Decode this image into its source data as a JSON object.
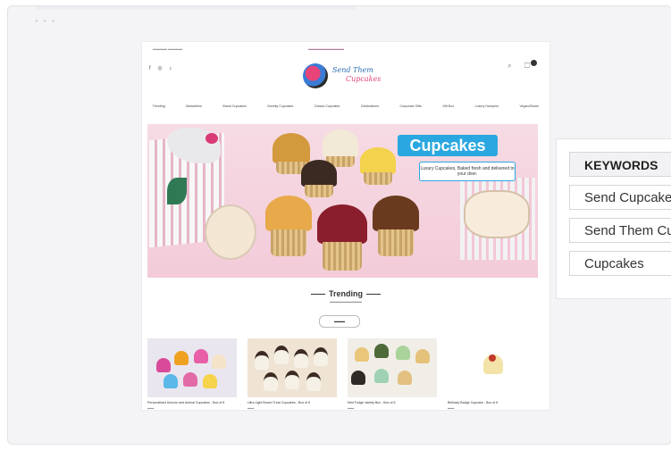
{
  "site": {
    "logo_line1": "Send Them",
    "logo_line2": "Cupcakes",
    "nav": [
      "Trending",
      "Bestsellers",
      "Brand Cupcakes",
      "Novelty Cupcakes",
      "Classic Cupcakes",
      "Celebrations",
      "Corporate Gifts",
      "Gift Box",
      "Luxury Hampers",
      "Vegan/Gluten"
    ],
    "hero": {
      "title": "Cupcakes",
      "subtitle": "Luxury Cupcakes, Baked fresh and delivered to your door."
    },
    "trending": {
      "title": "Trending"
    },
    "products": [
      {
        "name": "Personalised Unicorn and Animal Cupcakes - Box of 6"
      },
      {
        "name": "Ultra Light Brown Treat Cupcakes - Box of 6"
      },
      {
        "name": "Mint Fudge Variety Box - Box of 6"
      },
      {
        "name": "Birthday Badge Cupcake - Box of 6"
      }
    ]
  },
  "keywords": {
    "header": "KEYWORDS",
    "items": [
      "Send Cupcakes",
      "Send Them Cupcakes",
      "Cupcakes"
    ]
  },
  "colors": {
    "accent_blue": "#2aa7e0",
    "brand_pink": "#e0427a",
    "hero_bg": "#f3cbd9"
  }
}
